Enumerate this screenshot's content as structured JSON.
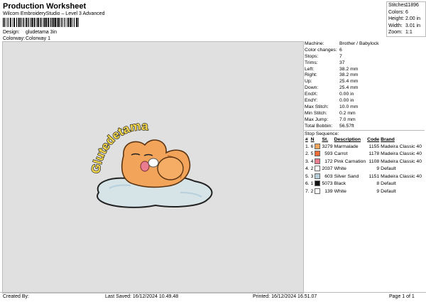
{
  "header": {
    "title": "Production Worksheet",
    "subtitle": "Wilcom EmbroideryStudio – Level 3 Advanced",
    "design_label": "Design:",
    "design_value": "gludetama 3in",
    "colorway_label": "Colorway:",
    "colorway_value": "Colorway 1"
  },
  "stats": [
    {
      "k": "Stitches:",
      "v": "11896"
    },
    {
      "k": "Colors:",
      "v": "6"
    },
    {
      "k": "Height:",
      "v": "2.00 in"
    },
    {
      "k": "Width:",
      "v": "3.01 in"
    },
    {
      "k": "Zoom:",
      "v": "1:1"
    }
  ],
  "machine": [
    {
      "k": "Machine:",
      "v": "Brother / Babylock"
    },
    {
      "k": "Color changes:",
      "v": "6"
    },
    {
      "k": "Stops:",
      "v": "7"
    },
    {
      "k": "Trims:",
      "v": "37"
    },
    {
      "k": "Left:",
      "v": "38.2 mm"
    },
    {
      "k": "Right:",
      "v": "38.2 mm"
    },
    {
      "k": "Up:",
      "v": "25.4 mm"
    },
    {
      "k": "Down:",
      "v": "25.4 mm"
    },
    {
      "k": "EndX:",
      "v": "0.00 in"
    },
    {
      "k": "EndY:",
      "v": "0.00 in"
    },
    {
      "k": "Max Stitch:",
      "v": "10.0 mm"
    },
    {
      "k": "Min Stitch:",
      "v": "0.2 mm"
    },
    {
      "k": "Max Jump:",
      "v": "7.0 mm"
    },
    {
      "k": "Total Bobbin:",
      "v": "56.57ft"
    }
  ],
  "stop_sequence": {
    "label": "Stop Sequence:",
    "headers": [
      "#",
      "N",
      "St.",
      "Description",
      "Code",
      "Brand"
    ],
    "rows": [
      {
        "num": "1.",
        "n": "6",
        "color": "#f2a45a",
        "st": "3279",
        "desc": "Marmalade",
        "code": "1155",
        "brand": "Madeira Classic 40"
      },
      {
        "num": "2.",
        "n": "5",
        "color": "#ee6a36",
        "st": "593",
        "desc": "Carrot",
        "code": "1178",
        "brand": "Madeira Classic 40"
      },
      {
        "num": "3.",
        "n": "4",
        "color": "#e97d8f",
        "st": "172",
        "desc": "Pink Carnation",
        "code": "1108",
        "brand": "Madeira Classic 40"
      },
      {
        "num": "4.",
        "n": "2",
        "color": "#ffffff",
        "st": "2037",
        "desc": "White",
        "code": "9",
        "brand": "Default"
      },
      {
        "num": "5.",
        "n": "3",
        "color": "#b8cfdc",
        "st": "603",
        "desc": "Silver Sand",
        "code": "1151",
        "brand": "Madeira Classic 40"
      },
      {
        "num": "6.",
        "n": "1",
        "color": "#111111",
        "st": "5073",
        "desc": "Black",
        "code": "8",
        "brand": "Default"
      },
      {
        "num": "7.",
        "n": "2",
        "color": "#ffffff",
        "st": "139",
        "desc": "White",
        "code": "9",
        "brand": "Default"
      }
    ]
  },
  "design_art": {
    "text": "Glutedetama"
  },
  "footer": {
    "created_by": "Created By:",
    "last_saved": "Last Saved: 16/12/2024 10.49.48",
    "printed": "Printed: 16/12/2024 16.51.07",
    "page": "Page 1 of 1"
  }
}
